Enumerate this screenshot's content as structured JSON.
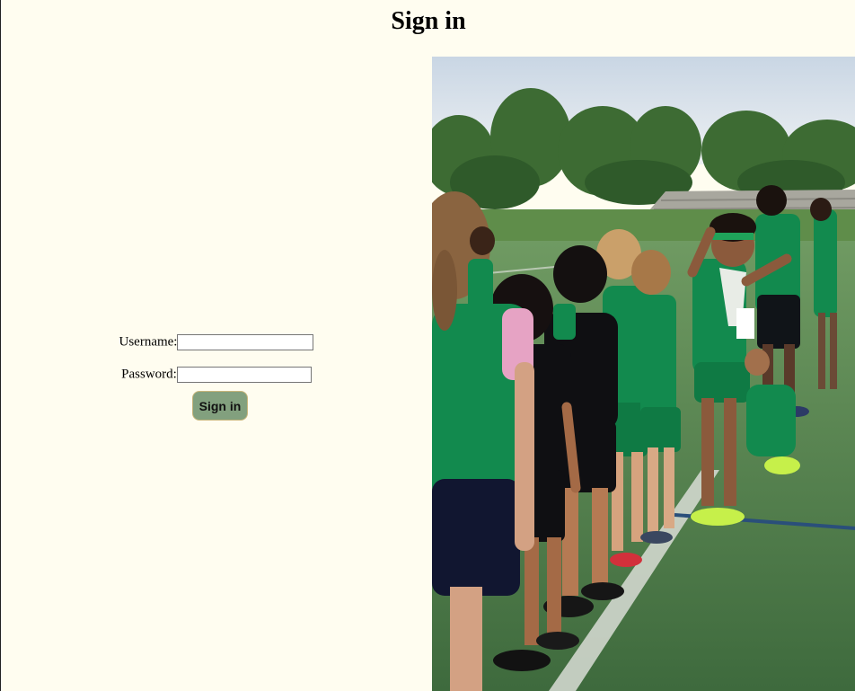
{
  "page": {
    "title": "Sign in"
  },
  "form": {
    "username_label": "Username:",
    "username_value": "",
    "password_label": "Password:",
    "password_value": "",
    "submit_label": "Sign in"
  },
  "colors": {
    "background": "#fffdf0",
    "button": "#82a07e",
    "button_border": "#c8b57a",
    "jersey_green": "#128a4e",
    "field_turf": "#4f7a49"
  },
  "photo": {
    "subject": "children-lined-up-on-athletic-field"
  }
}
